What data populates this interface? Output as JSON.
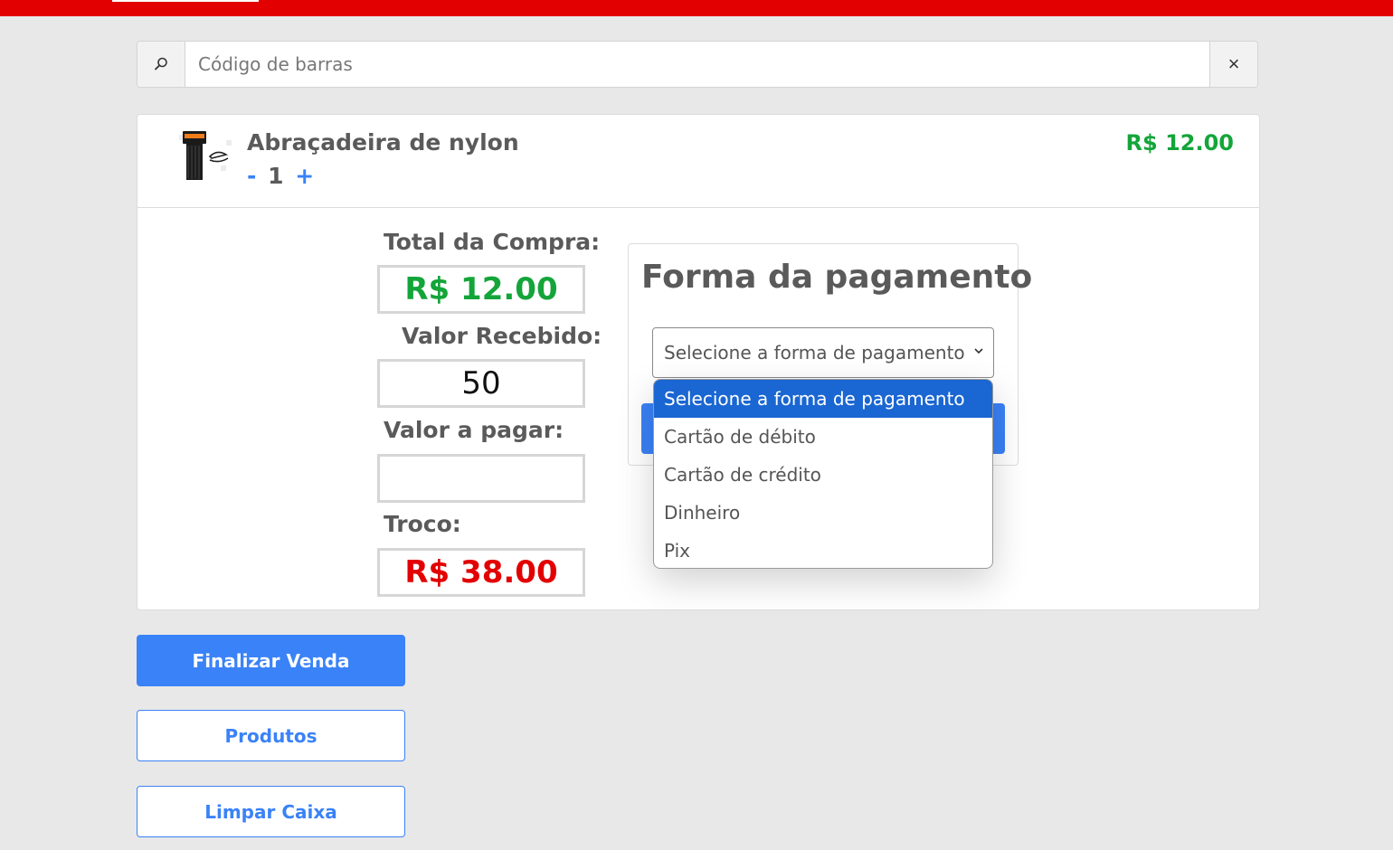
{
  "search": {
    "placeholder": "Código de barras",
    "value": "",
    "clear_glyph": "×"
  },
  "cart": {
    "items": [
      {
        "name": "Abraçadeira de nylon",
        "quantity": "1",
        "decrement_label": "-",
        "increment_label": "+",
        "price": "R$ 12.00"
      }
    ]
  },
  "totals": {
    "total_label": "Total da Compra:",
    "total_value": "R$ 12.00",
    "received_label": "Valor Recebido:",
    "received_value": "50",
    "to_pay_label": "Valor a pagar:",
    "to_pay_value": "",
    "change_label": "Troco:",
    "change_value": "R$ 38.00"
  },
  "payment": {
    "title": "Forma da pagamento",
    "selected": "Selecione a forma de pagamento",
    "options": [
      "Selecione a forma de pagamento",
      "Cartão de débito",
      "Cartão de crédito",
      "Dinheiro",
      "Pix"
    ]
  },
  "actions": {
    "finalize_label": "Finalizar Venda",
    "products_label": "Produtos",
    "clear_label": "Limpar Caixa"
  },
  "icons": {
    "search": "search-icon",
    "close": "close-icon",
    "chevron": "chevron-down-icon"
  },
  "colors": {
    "header_red": "#e20000",
    "accent_blue": "#3a82f7",
    "price_green": "#14a53a",
    "change_red": "#e20000",
    "option_highlight": "#1a66d2"
  }
}
